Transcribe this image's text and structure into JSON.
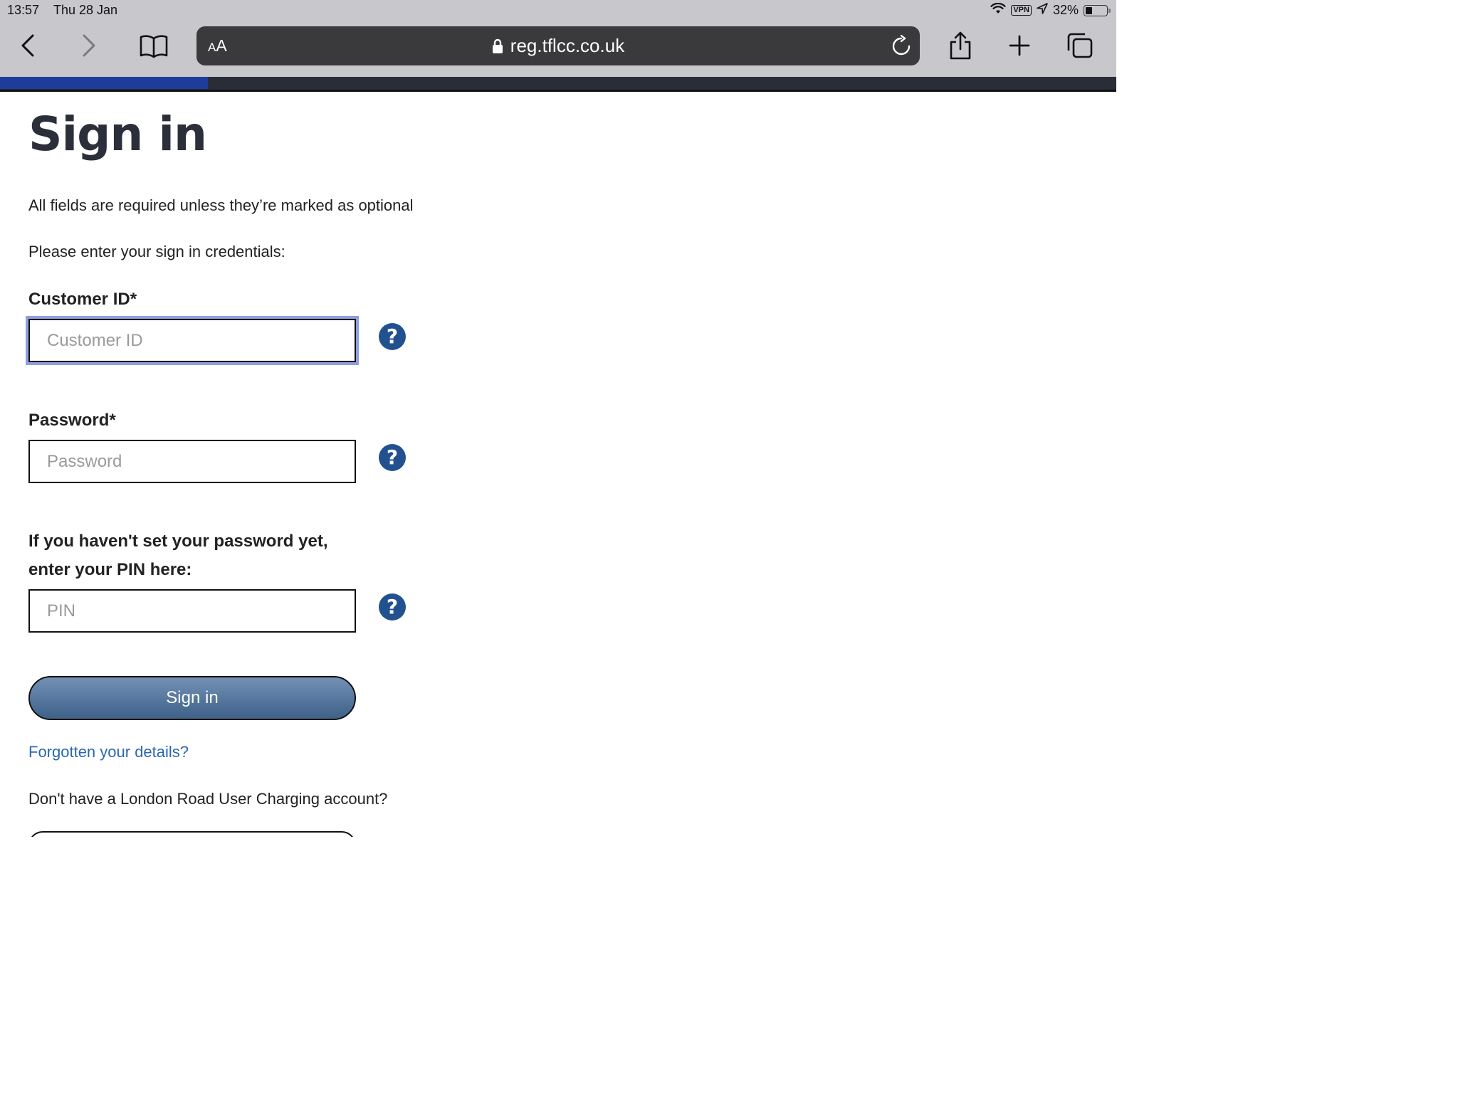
{
  "status_bar": {
    "time": "13:57",
    "date": "Thu 28 Jan",
    "vpn": "VPN",
    "battery": "32%",
    "battery_level": 0.32
  },
  "browser": {
    "text_size_label_small": "A",
    "text_size_label_large": "A",
    "url": "reg.tflcc.co.uk",
    "icons": [
      "back-icon",
      "forward-icon",
      "bookmarks-icon",
      "lock-icon",
      "reload-icon",
      "share-icon",
      "new-tab-icon",
      "tabs-icon"
    ]
  },
  "page": {
    "title": "Sign in",
    "required_note": "All fields are required unless they’re marked as optional",
    "instructions": "Please enter your sign in credentials:",
    "customer_id": {
      "label": "Customer ID*",
      "placeholder": "Customer ID",
      "value": ""
    },
    "password": {
      "label": "Password*",
      "placeholder": "Password",
      "value": ""
    },
    "pin": {
      "label_line1": "If you haven't set your password yet,",
      "label_line2": "enter your PIN here:",
      "placeholder": "PIN",
      "value": ""
    },
    "help_symbol": "?",
    "signin_button": "Sign in",
    "forgotten_link": "Forgotten your details?",
    "no_account_text": "Don't have a London Road User Charging account?"
  },
  "colors": {
    "header_bar": "#282d38",
    "header_accent": "#1e3d9b",
    "help_icon": "#22518f",
    "link": "#2a68ad",
    "button_top": "#7391b5",
    "button_bottom": "#3e6188"
  }
}
